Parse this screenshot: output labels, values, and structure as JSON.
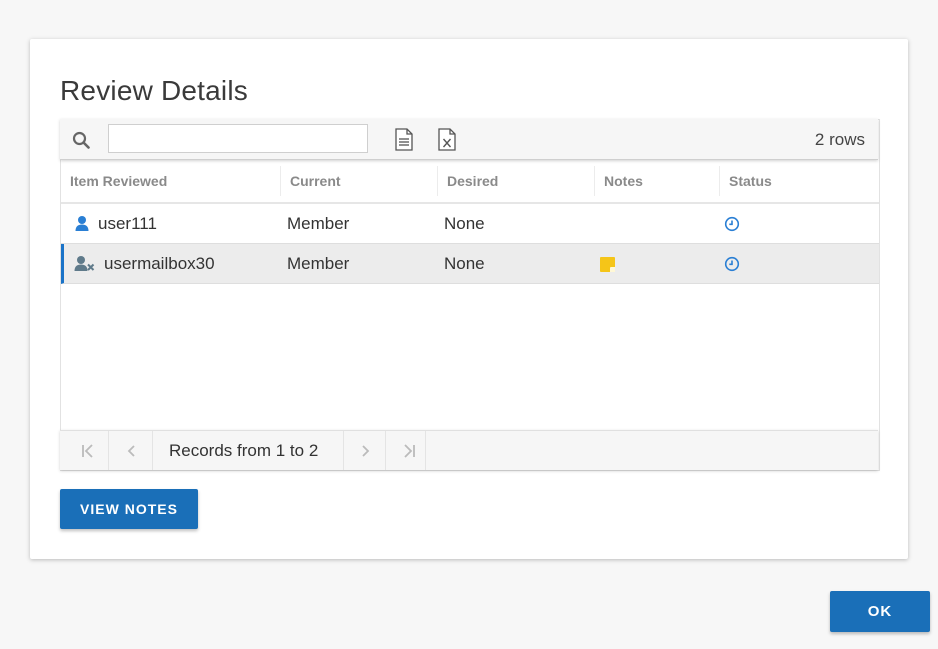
{
  "dialog": {
    "title": "Review Details"
  },
  "toolbar": {
    "search_placeholder": "",
    "rows_label": "2 rows",
    "icons": [
      "search-icon",
      "export-text-icon",
      "export-excel-icon"
    ]
  },
  "table": {
    "columns": [
      "Item Reviewed",
      "Current",
      "Desired",
      "Notes",
      "Status"
    ],
    "rows": [
      {
        "item": "user111",
        "icon": "user-icon",
        "current": "Member",
        "desired": "None",
        "has_note": false,
        "status_icon": "clock-icon"
      },
      {
        "item": "usermailbox30",
        "icon": "user-remove-icon",
        "current": "Member",
        "desired": "None",
        "has_note": true,
        "status_icon": "clock-icon"
      }
    ]
  },
  "pager": {
    "label": "Records from 1 to 2"
  },
  "buttons": {
    "view_notes": "VIEW NOTES",
    "ok": "OK"
  },
  "colors": {
    "accent": "#1a6fb8",
    "note": "#f5c518",
    "user_icon": "#2a7fd4",
    "user_remove_icon": "#5f7a8a"
  }
}
